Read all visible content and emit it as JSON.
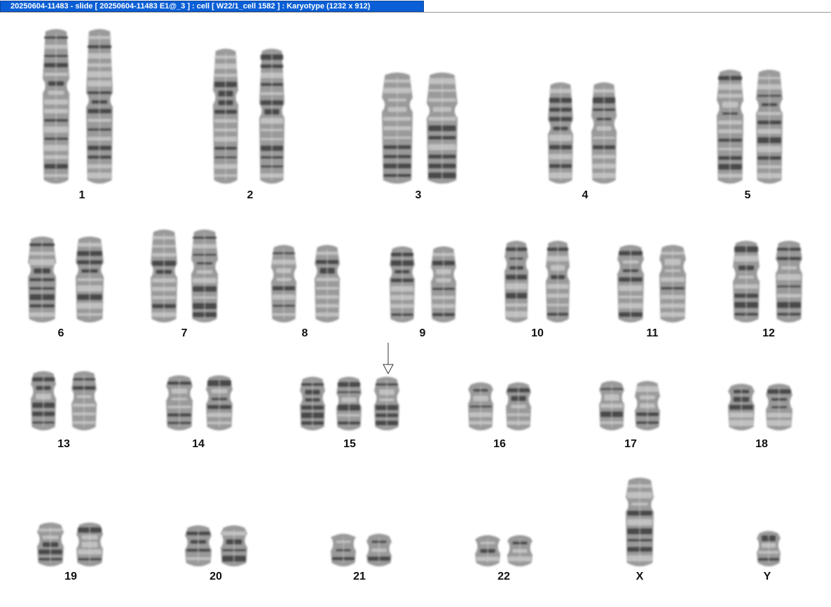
{
  "window": {
    "title": "20250604-11483 - slide [ 20250604-11483 E1@_3 ] : cell [ W22/1_cell 1582 ] : Karyotype  (1232 x 912)"
  },
  "karyotype": {
    "colors": {
      "chromatid": "#9a9a9a",
      "dark_band": "#3a3a3a",
      "light_band": "#d2d2d2",
      "label": "#111111",
      "arrow": "#333333"
    },
    "groups": [
      {
        "label": "1",
        "chromosome_count": 2
      },
      {
        "label": "2",
        "chromosome_count": 2
      },
      {
        "label": "3",
        "chromosome_count": 2
      },
      {
        "label": "4",
        "chromosome_count": 2
      },
      {
        "label": "5",
        "chromosome_count": 2
      },
      {
        "label": "6",
        "chromosome_count": 2
      },
      {
        "label": "7",
        "chromosome_count": 2
      },
      {
        "label": "8",
        "chromosome_count": 2
      },
      {
        "label": "9",
        "chromosome_count": 2
      },
      {
        "label": "10",
        "chromosome_count": 2
      },
      {
        "label": "11",
        "chromosome_count": 2
      },
      {
        "label": "12",
        "chromosome_count": 2
      },
      {
        "label": "13",
        "chromosome_count": 2
      },
      {
        "label": "14",
        "chromosome_count": 2
      },
      {
        "label": "15",
        "chromosome_count": 3,
        "annotation": "down-arrow-icon"
      },
      {
        "label": "16",
        "chromosome_count": 2
      },
      {
        "label": "17",
        "chromosome_count": 2
      },
      {
        "label": "18",
        "chromosome_count": 2
      },
      {
        "label": "19",
        "chromosome_count": 2
      },
      {
        "label": "20",
        "chromosome_count": 2
      },
      {
        "label": "21",
        "chromosome_count": 2
      },
      {
        "label": "22",
        "chromosome_count": 2
      },
      {
        "label": "X",
        "chromosome_count": 1
      },
      {
        "label": "Y",
        "chromosome_count": 1
      }
    ]
  }
}
